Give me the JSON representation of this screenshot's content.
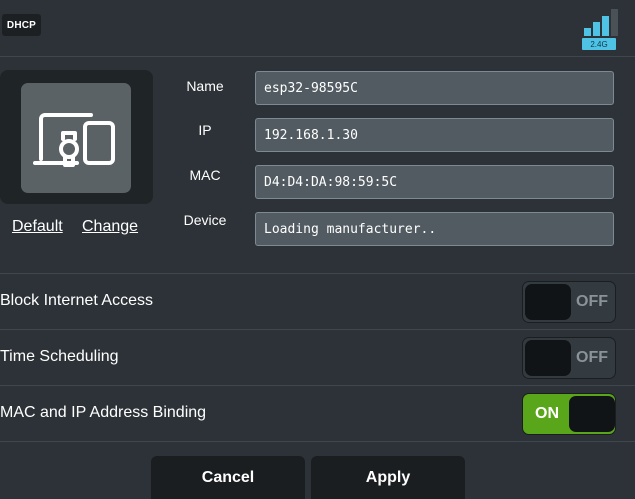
{
  "header": {
    "badge": "DHCP",
    "band": "2.4G"
  },
  "device_card": {
    "default_link": "Default",
    "change_link": "Change"
  },
  "fields": {
    "name_label": "Name",
    "name_value": "esp32-98595C",
    "ip_label": "IP",
    "ip_value": "192.168.1.30",
    "mac_label": "MAC",
    "mac_value": "D4:D4:DA:98:59:5C",
    "device_label": "Device",
    "device_value": "Loading manufacturer.."
  },
  "options": {
    "block_internet": {
      "label": "Block Internet Access",
      "state": "OFF"
    },
    "time_scheduling": {
      "label": "Time Scheduling",
      "state": "OFF"
    },
    "mac_ip_binding": {
      "label": "MAC and IP Address Binding",
      "state": "ON"
    }
  },
  "buttons": {
    "cancel": "Cancel",
    "apply": "Apply"
  },
  "colors": {
    "background": "#2c3237",
    "toggle_on": "#5aa61a",
    "signal": "#4fc3e6"
  },
  "icons": {
    "device": "iot-device-icon",
    "signal": "wifi-signal-icon"
  }
}
